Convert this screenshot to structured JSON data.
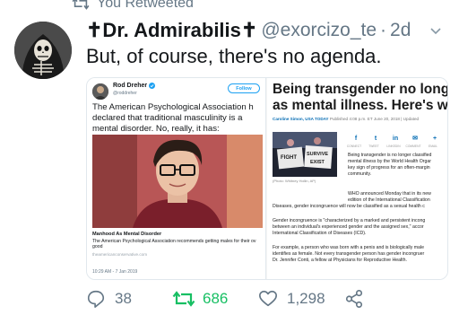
{
  "retweet": {
    "label": "You Retweeted",
    "icon": "retweet-icon"
  },
  "tweet": {
    "display_name": "✝Dr. Admirabilis✝",
    "handle": "@exorcizo_te",
    "separator": "·",
    "time": "2d",
    "text": "But, of course, there's no agenda.",
    "avatar_icon": "skeleton-avatar"
  },
  "embedded_tweet": {
    "name": "Rod Dreher",
    "handle": "@roddreher",
    "follow_label": "Follow",
    "text": "The American Psychological Association h declared that traditional masculinity is a mental disorder. No, really, it has:",
    "card_title": "Manhood As Mental Disorder",
    "card_desc_1": "The American Psychological Association recommends getting males for their ov",
    "card_desc_2": "good",
    "card_site": "theamericanconservative.com",
    "timestamp": "10:29 AM - 7 Jan 2019"
  },
  "article": {
    "title_1": "Being transgender no longer c",
    "title_2": "as mental illness. Here's why",
    "author": "Caroline Simon, USA TODAY",
    "published": "Published 4:08 p.m. ET June 20, 2018 | Updated",
    "social": [
      "f",
      "t",
      "in",
      "✉",
      "+"
    ],
    "social_labels": [
      "CONNECT",
      "TWEET",
      "LINKEDIN",
      "COMMENT",
      "EMAIL"
    ],
    "photo_caption": "(Photo: Whitney Hollin, AP)",
    "photo_sign_1": "FIGHT",
    "photo_sign_2": "SURVIVE",
    "photo_sign_3": "EXIST",
    "p1": [
      "Being transgender is no longer classified",
      "mental illness by the World Health Orgar",
      "key sign of progress for an often-margin",
      "community."
    ],
    "p2": [
      "WHO announced Monday that in its new",
      "edition of the International Classification",
      "Diseases, gender incongruence will now be classified as a sexual health c"
    ],
    "p3": [
      "Gender incongruence is \"characterized by a marked and persistent incong",
      "between an individual's experienced gender and the assigned sex,\" accor",
      "International Classification of Diseases (ICD)."
    ],
    "p4": [
      "For example, a person who was born with a penis and is biologically male",
      "identifies as female. Not every transgender person has gender incongruer",
      "Dr. Jennifer Conti, a fellow at Physicians for Reproductive Health."
    ]
  },
  "actions": {
    "reply_count": "38",
    "retweet_count": "686",
    "like_count": "1,298",
    "colors": {
      "retweeted": "#17bf63",
      "muted": "#657786"
    }
  }
}
